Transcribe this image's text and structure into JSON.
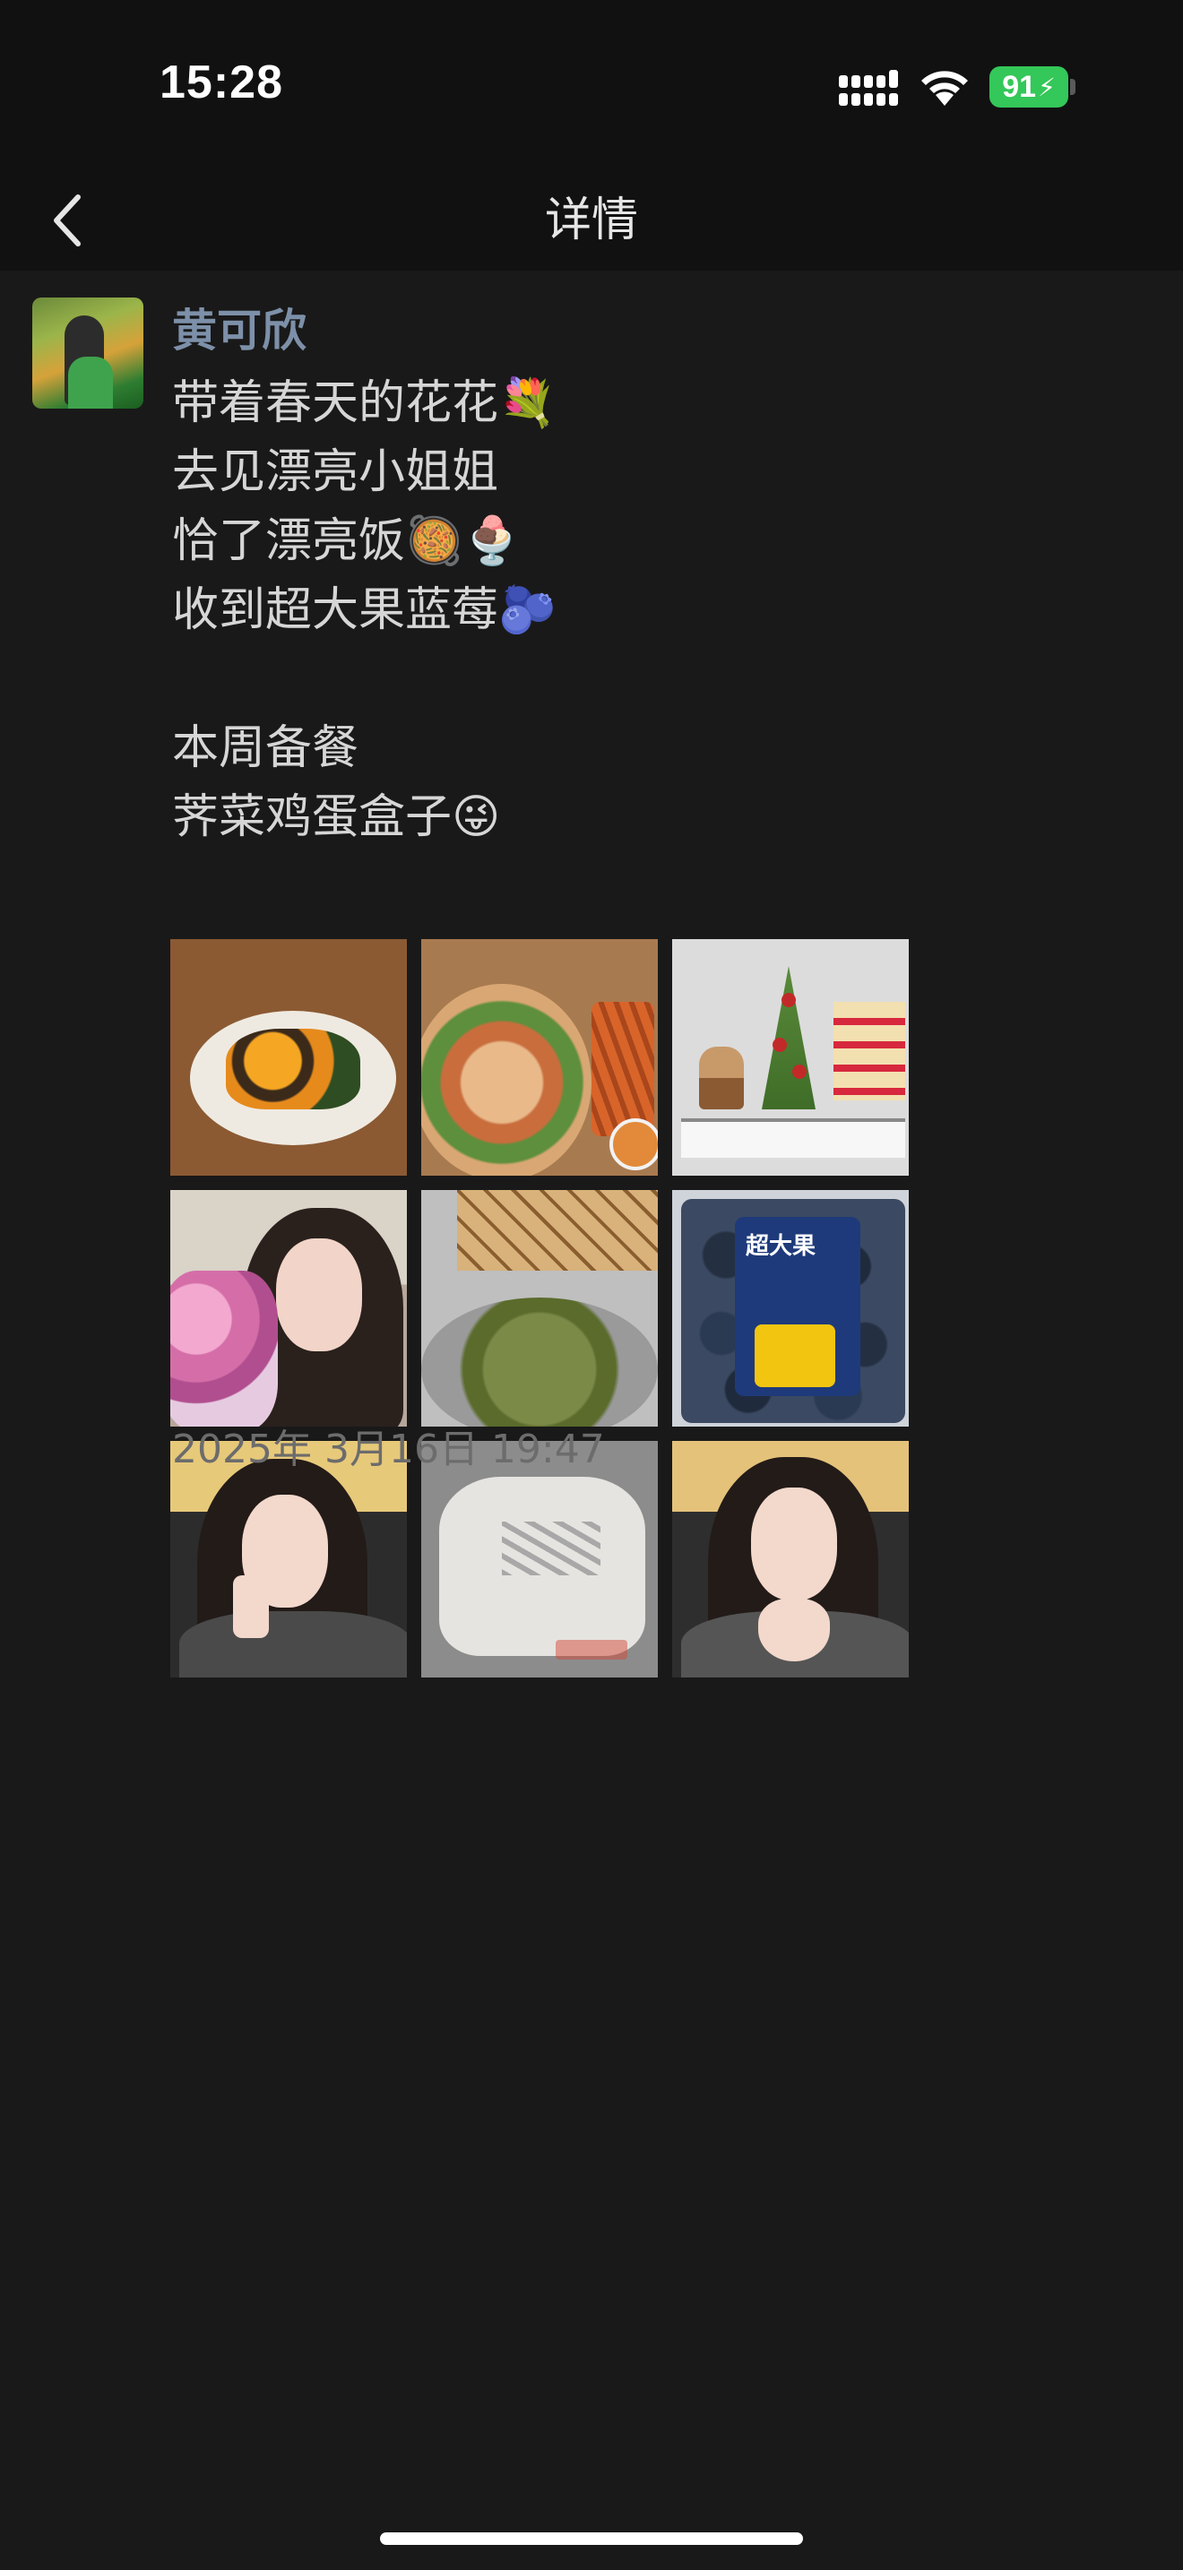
{
  "status_bar": {
    "time": "15:28",
    "battery": "91",
    "icons": [
      "signal-icon",
      "wifi-icon",
      "battery-icon",
      "charging-bolt-icon"
    ]
  },
  "nav": {
    "title": "详情",
    "back_icon": "chevron-left-icon"
  },
  "post": {
    "author": "黄可欣",
    "text_lines": [
      "带着春天的花花💐",
      "去见漂亮小姐姐",
      "恰了漂亮饭🥘🍨",
      "收到超大果蓝莓🫐",
      "",
      "本周备餐",
      "荠菜鸡蛋盒子😜"
    ],
    "photos": [
      "photo-eggs-benedict",
      "photo-pizza-fries",
      "photo-pastry-display",
      "photo-selfie-flowers",
      "photo-sandwich-filling",
      "photo-blueberries",
      "photo-selfie-peace",
      "photo-sneakers",
      "photo-selfie-heart"
    ],
    "photo_texts": {
      "blueberry_tag": "超大果"
    },
    "timestamp": "2025年 3月16日 19:47"
  },
  "colors": {
    "background": "#191919",
    "bar_background": "#111111",
    "author_name": "#7d90a9",
    "body_text": "#d6d6d6",
    "timestamp": "#6c6c6c",
    "battery_green": "#34c759"
  }
}
